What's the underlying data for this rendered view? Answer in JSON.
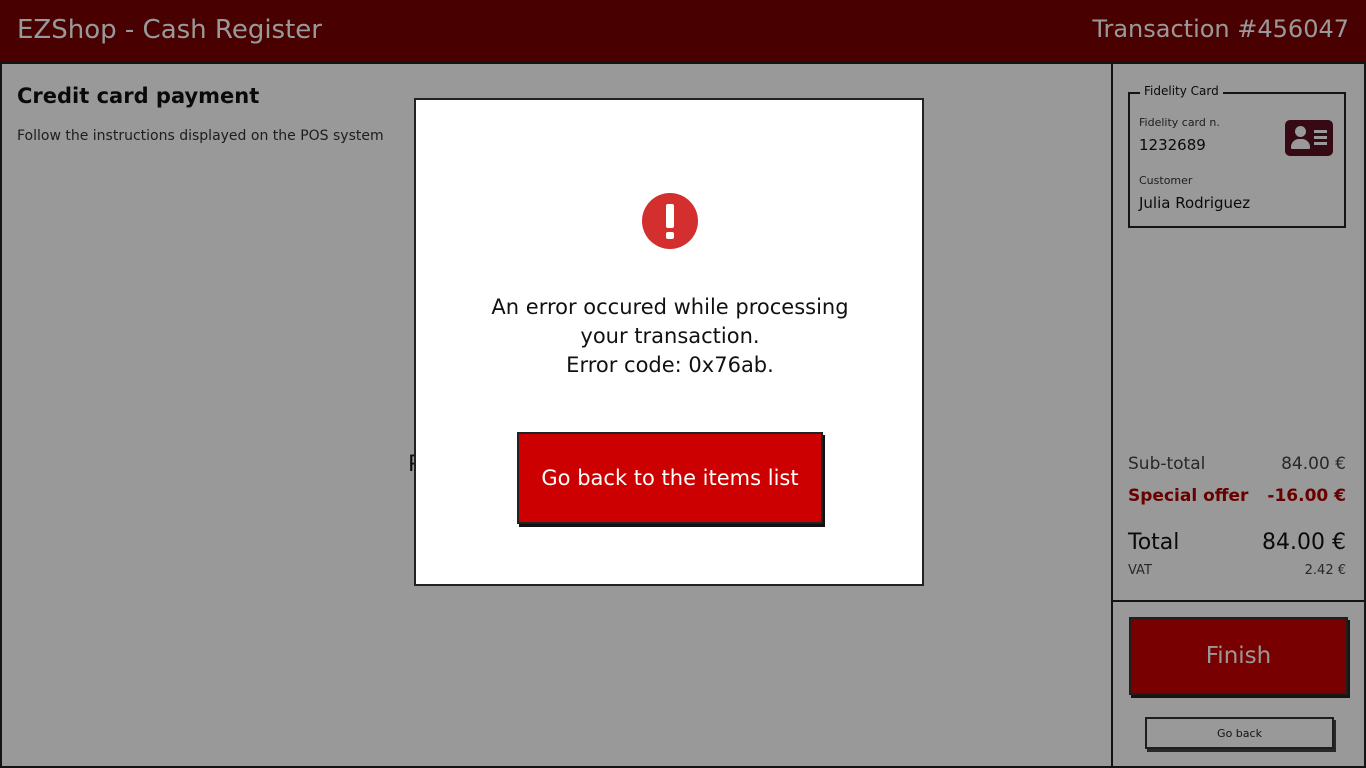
{
  "header": {
    "title": "EZShop - Cash Register",
    "transaction": "Transaction #456047"
  },
  "main": {
    "heading": "Credit card payment",
    "instructions": "Follow the instructions displayed on the POS system",
    "partial_text": "P"
  },
  "fidelity_card": {
    "legend": "Fidelity Card",
    "card_number_label": "Fidelity card n.",
    "card_number": "1232689",
    "customer_label": "Customer",
    "customer_name": "Julia Rodriguez",
    "icon": "id-card-icon"
  },
  "totals": {
    "subtotal_label": "Sub-total",
    "subtotal_value": "84.00 €",
    "special_offer_label": "Special offer",
    "special_offer_value": "-16.00 €",
    "total_label": "Total",
    "total_value": "84.00 €",
    "vat_label": "VAT",
    "vat_value": "2.42 €"
  },
  "actions": {
    "finish_label": "Finish",
    "go_back_label": "Go back"
  },
  "modal": {
    "icon": "error-icon",
    "message_lines": [
      "An error occured while processing",
      "your transaction.",
      "Error code: 0x76ab."
    ],
    "button_label": "Go back to the items list"
  },
  "colors": {
    "header_bg": "#7a0000",
    "primary_button": "#cc0000",
    "special_offer_text": "#b00000",
    "error_icon": "#d32f2f",
    "card_icon": "#5a0f22",
    "overlay": "rgba(0,0,0,0.4)"
  }
}
